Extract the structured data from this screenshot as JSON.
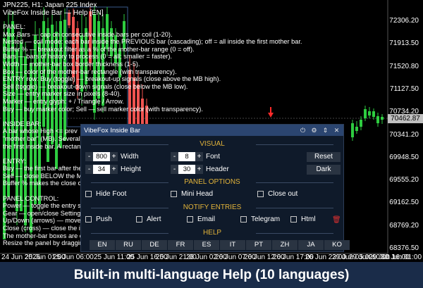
{
  "chart": {
    "symbol_line": "JPN225, H1:  Japan 225 Index",
    "title_line2": "VibeFox Inside Bar — Help [EN]",
    "current_price": "70462.87",
    "price_ticks": [
      "72306.20",
      "71913.50",
      "71520.80",
      "71127.50",
      "70734.20",
      "70341.20",
      "69948.50",
      "69555.20",
      "69162.50",
      "68769.20",
      "68376.50"
    ],
    "time_ticks": [
      "24 Jun 2026",
      "25 Jun 01:00",
      "25 Jun 06:00",
      "25 Jun 11:00",
      "25 Jun 16:00",
      "25 Jun 21:00",
      "26 Jun 02:00",
      "26 Jun 07:00",
      "26 Jun 12:00",
      "26 Jun 17:00",
      "26 Jun 23:00",
      "29 Jun 05:00",
      "29 Jun 10:00",
      "29 Jun 16:00",
      "30 Jun 01:00"
    ],
    "colors": {
      "bull": "#26a69a",
      "bull_bright": "#2ecc40",
      "bear": "#ef5350",
      "arrow": "#ff2a2a",
      "box": "#3a5a8c"
    }
  },
  "help": {
    "lines": [
      "PANEL:",
      "Max Bars — cap on consecutive inside bars per coil (1-20).",
      "Nested — coil mode: each bar inside the PREVIOUS bar (cascading); off = all inside the first mother bar.",
      "Buffer % — breakout filter as a % of the mother-bar range (0 = off).",
      "Bars — bars of history to process (0 = all; smaller = faster).",
      "Width — mother-bar box border thickness (1-5).",
      "Box — color of the mother-bar rectangle (with transparency).",
      "ENTRY row: Buy (toggle) — breakout-up signals (close above the MB high).",
      "Sell (toggle) — breakout-down signals (close below the MB low).",
      "Size — entry marker size in pixels (8-40).",
      "Marker — entry glyph: + / Triangle / Arrow.",
      "Buy — buy marker color; Sell — sell marker color (with transparency).",
      "",
      "INSIDE BAR:",
      "A bar whose High <= prev",
      "\"mother bar\" (MB). Several",
      "the first inside bar. A rectan",
      "",
      "ENTRY:",
      "Buy — the first bar after the",
      "Sell — close BELOW the MB",
      "Buffer % makes the close cl",
      "",
      "PANEL CONTROL:",
      "Power — toggle the entry si",
      "Gear — open/close Settings",
      "Up/Down (arrows) — move t",
      "Close (cross) — close the in",
      "The mother-bar boxes are c",
      "Resize the panel by draggin"
    ]
  },
  "panel": {
    "title": "VibeFox Inside Bar",
    "header_icons": [
      "power-icon",
      "gear-icon",
      "arrows-icon",
      "close-icon"
    ],
    "visual": {
      "section": "VISUAL",
      "width": {
        "label": "Width",
        "value": "800"
      },
      "height": {
        "label": "Height",
        "value": "34"
      },
      "font": {
        "label": "Font",
        "value": "8"
      },
      "header": {
        "label": "Header",
        "value": "30"
      },
      "reset_label": "Reset",
      "theme_label": "Dark"
    },
    "options": {
      "section": "PANEL OPTIONS",
      "hide_foot": "Hide Foot",
      "mini_head": "Mini Head",
      "close_out": "Close out"
    },
    "notify": {
      "section": "NOTIFY ENTRIES",
      "push": "Push",
      "alert": "Alert",
      "email": "Email",
      "telegram": "Telegram",
      "html": "Html"
    },
    "help": {
      "section": "HELP",
      "languages": [
        "EN",
        "RU",
        "DE",
        "FR",
        "ES",
        "IT",
        "PT",
        "ZH",
        "JA",
        "KO"
      ]
    }
  },
  "caption": "Built-in multi-language Help (10 languages)"
}
